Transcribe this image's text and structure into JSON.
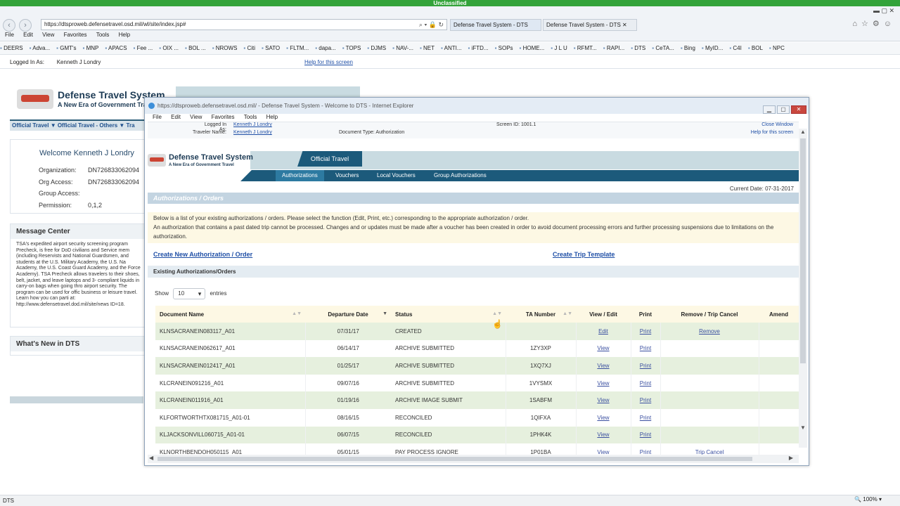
{
  "banner": "Unclassified",
  "browser": {
    "address": "https://dtsproweb.defensetravel.osd.mil/wl/site/index.jsp#",
    "tabs": [
      "Defense Travel System - DTS",
      "Defense Travel System - DTS"
    ],
    "menu": [
      "File",
      "Edit",
      "View",
      "Favorites",
      "Tools",
      "Help"
    ],
    "favorites": [
      "DEERS",
      "Adva...",
      "GMT's",
      "MNP",
      "APACS",
      "Fee ...",
      "OIX ...",
      "BOL ...",
      "NROWS",
      "Citi",
      "SATO",
      "FLTM...",
      "dapa...",
      "TOPS",
      "DJMS",
      "NAV-...",
      "NET",
      "ANTI...",
      "iFTD...",
      "SOPs",
      "HOME...",
      "J L U",
      "RFMT...",
      "RAPI...",
      "DTS",
      "CeTA...",
      "Bing",
      "MyID...",
      "C4I",
      "BOL",
      "NPC"
    ],
    "status_left": "DTS",
    "zoom": "100%"
  },
  "background": {
    "logged_in_label": "Logged In As:",
    "logged_in_user": "Kenneth J Londry",
    "help_link": "Help for this screen",
    "logo_title": "Defense Travel System",
    "logo_sub": "A New Era of Government Tra",
    "nav": "Official Travel   ▼ Official Travel - Others   ▼ Tra",
    "welcome": "Welcome Kenneth J Londry",
    "org_label": "Organization:",
    "org_value": "DN726833062094",
    "orgaccess_label": "Org Access:",
    "orgaccess_value": "DN726833062094",
    "group_label": "Group Access:",
    "perm_label": "Permission:",
    "perm_value": "0,1,2",
    "message_center": "Message Center",
    "message_text": "TSA's expedited airport security screening program Precheck, is free for DoD civilians and Service mem (including Reservists and National Guardsmen, and students at the U.S. Military Academy, the U.S. Na Academy, the U.S. Coast Guard Academy, and the Force Academy). TSA Precheck allows travelers to their shoes, belt, jacket, and leave laptops and 3- compliant liquids in carry-on bags when going thro airport security. The program can be used for offic business or leisure travel. Learn how you can parti at: http://www.defensetravel.dod.mil/site/news ID=18.",
    "whats_new": "What's New in DTS"
  },
  "popup": {
    "title": "https://dtsproweb.defensetravel.osd.mil/ - Defense Travel System - Welcome to DTS - Internet Explorer",
    "menu": [
      "File",
      "Edit",
      "View",
      "Favorites",
      "Tools",
      "Help"
    ],
    "logged_in_label": "Logged In As:",
    "logged_in_user": "Kenneth J Londry",
    "traveler_label": "Traveler Name:",
    "traveler_name": "Kenneth J Londry",
    "doc_type": "Document Type: Authorization",
    "screen_id": "Screen ID: 1001.1",
    "close_window": "Close Window",
    "help": "Help for this screen",
    "logo_title": "Defense Travel System",
    "logo_sub": "A New Era of Government Travel",
    "official_travel": "Official Travel",
    "subnav": [
      "Authorizations",
      "Vouchers",
      "Local Vouchers",
      "Group Authorizations"
    ],
    "current_date": "Current Date: 07-31-2017",
    "section_title": "Authorizations / Orders",
    "notice_1": "Below is a list of your existing authorizations / orders. Please select the function (Edit, Print, etc.) corresponding to the appropriate authorization / order.",
    "notice_2": "An authorization that contains a past dated trip cannot be processed. Changes and or updates must be made after a voucher has been created in order to avoid document processing errors and further processing suspensions due to limitations on the authorization.",
    "create_new": "Create New Authorization / Order",
    "create_template": "Create Trip Template",
    "existing_title": "Existing Authorizations/Orders",
    "show_label": "Show",
    "show_value": "10",
    "entries_label": "entries",
    "columns": [
      "Document Name",
      "Departure Date",
      "Status",
      "TA Number",
      "View / Edit",
      "Print",
      "Remove / Trip Cancel",
      "Amend"
    ],
    "rows": [
      {
        "doc": "KLNSACRANEIN083117_A01",
        "date": "07/31/17",
        "status": "CREATED",
        "ta": "",
        "view": "Edit",
        "print": "Print",
        "remove": "Remove"
      },
      {
        "doc": "KLNSACRANEIN062617_A01",
        "date": "06/14/17",
        "status": "ARCHIVE SUBMITTED",
        "ta": "1ZY3XP",
        "view": "View",
        "print": "Print",
        "remove": ""
      },
      {
        "doc": "KLNSACRANEIN012417_A01",
        "date": "01/25/17",
        "status": "ARCHIVE SUBMITTED",
        "ta": "1XQ7XJ",
        "view": "View",
        "print": "Print",
        "remove": ""
      },
      {
        "doc": "KLCRANEIN091216_A01",
        "date": "09/07/16",
        "status": "ARCHIVE SUBMITTED",
        "ta": "1VYSMX",
        "view": "View",
        "print": "Print",
        "remove": ""
      },
      {
        "doc": "KLCRANEIN011916_A01",
        "date": "01/19/16",
        "status": "ARCHIVE IMAGE SUBMIT",
        "ta": "1SABFM",
        "view": "View",
        "print": "Print",
        "remove": ""
      },
      {
        "doc": "KLFORTWORTHTX081715_A01-01",
        "date": "08/16/15",
        "status": "RECONCILED",
        "ta": "1QIFXA",
        "view": "View",
        "print": "Print",
        "remove": ""
      },
      {
        "doc": "KLJACKSONVILL060715_A01-01",
        "date": "06/07/15",
        "status": "RECONCILED",
        "ta": "1PHK4K",
        "view": "View",
        "print": "Print",
        "remove": ""
      },
      {
        "doc": "KLNORTHBENDOH050115_A01",
        "date": "05/01/15",
        "status": "PAY PROCESS IGNORE",
        "ta": "1P01BA",
        "view": "View",
        "print": "Print",
        "remove": "Trip Cancel"
      }
    ]
  }
}
